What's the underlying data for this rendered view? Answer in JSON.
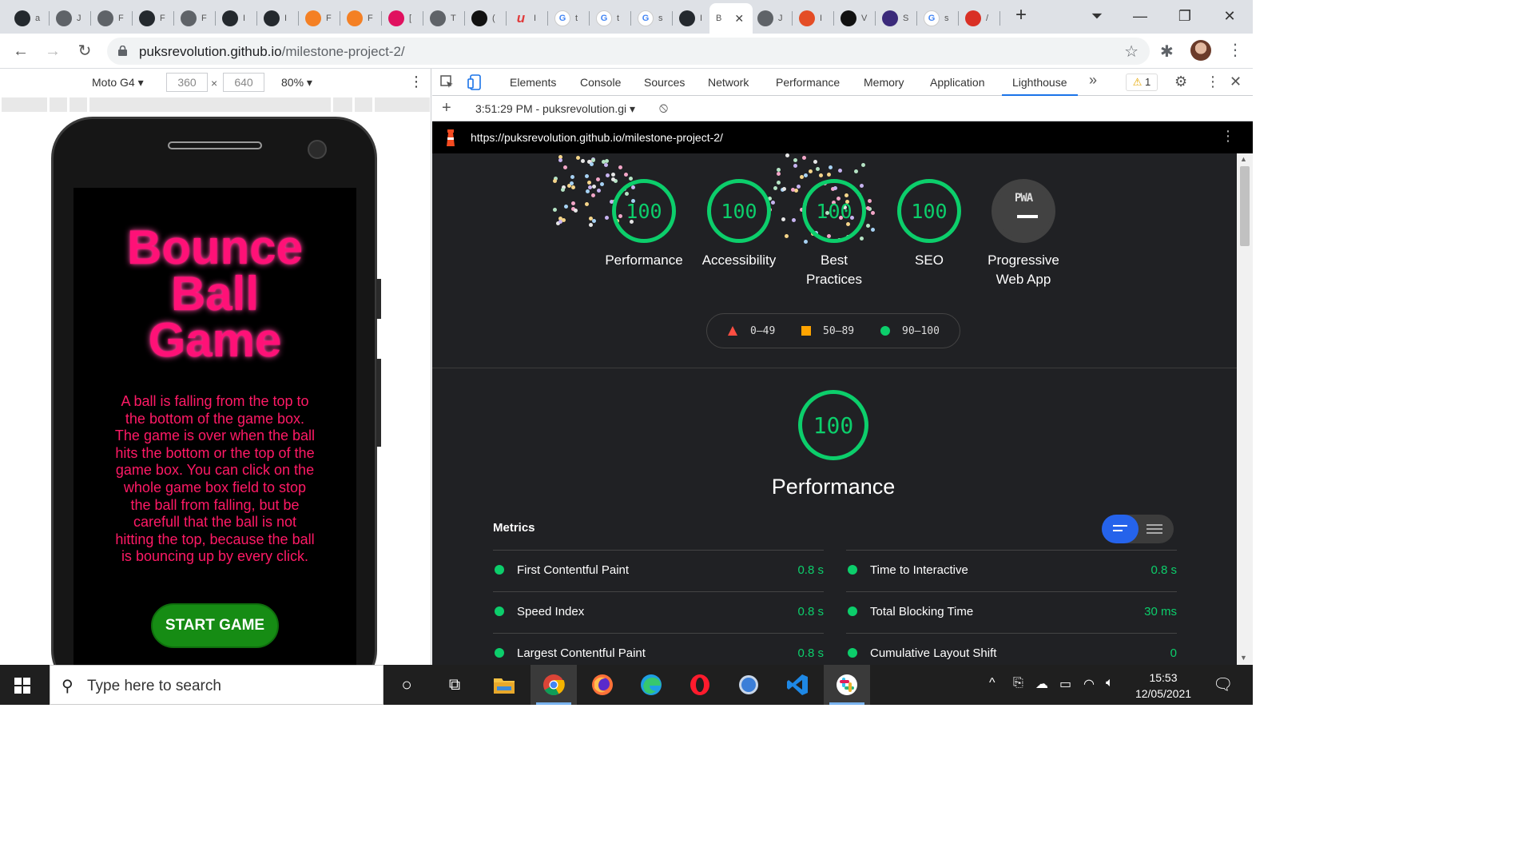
{
  "browser": {
    "tabs": [
      {
        "icon": "github-icon",
        "letter": "a"
      },
      {
        "icon": "globe-icon",
        "letter": "J"
      },
      {
        "icon": "globe-icon",
        "letter": "F"
      },
      {
        "icon": "github-icon",
        "letter": "F"
      },
      {
        "icon": "globe-icon",
        "letter": "F"
      },
      {
        "icon": "github-icon",
        "letter": "I"
      },
      {
        "icon": "github-icon",
        "letter": "I"
      },
      {
        "icon": "orange-g-icon",
        "letter": "F"
      },
      {
        "icon": "orange-g-icon",
        "letter": "F"
      },
      {
        "icon": "pink-square-icon",
        "letter": "["
      },
      {
        "icon": "globe-icon",
        "letter": "T"
      },
      {
        "icon": "codepen-icon",
        "letter": "("
      },
      {
        "icon": "u-icon",
        "letter": "I"
      },
      {
        "icon": "google-icon",
        "letter": "t"
      },
      {
        "icon": "google-icon",
        "letter": "t"
      },
      {
        "icon": "google-icon",
        "letter": "s"
      },
      {
        "icon": "github-icon",
        "letter": "I"
      },
      {
        "icon": "active-tab",
        "letter": "B"
      },
      {
        "icon": "globe-icon",
        "letter": "J"
      },
      {
        "icon": "html5-icon",
        "letter": "I"
      },
      {
        "icon": "dark-icon",
        "letter": "V"
      },
      {
        "icon": "vu-icon",
        "letter": "S"
      },
      {
        "icon": "google-icon",
        "letter": "s"
      },
      {
        "icon": "red-box-icon",
        "letter": "/"
      }
    ],
    "url_host": "puksrevolution.github.io",
    "url_path": "/milestone-project-2/"
  },
  "device": {
    "name": "Moto G4",
    "width": "360",
    "height": "640",
    "zoom": "80%"
  },
  "game": {
    "title_line1": "Bounce",
    "title_line2": "Ball",
    "title_line3": "Game",
    "description": "A ball is falling from the top to the bottom of the game box. The game is over when the ball hits the bottom or the top of the game box. You can click on the whole game box field to stop the ball from falling, but be carefull that the ball is not hitting the top, because the ball is bouncing up by every click.",
    "start_button": "START GAME"
  },
  "devtools": {
    "tabs": [
      "Elements",
      "Console",
      "Sources",
      "Network",
      "Performance",
      "Memory",
      "Application",
      "Lighthouse"
    ],
    "active_tab": "Lighthouse",
    "warnings": "1",
    "report_time": "3:51:29 PM - puksrevolution.gi",
    "report_url": "https://puksrevolution.github.io/milestone-project-2/"
  },
  "lighthouse": {
    "scores": [
      {
        "label": "Performance",
        "value": "100"
      },
      {
        "label": "Accessibility",
        "value": "100"
      },
      {
        "label": "Best Practices",
        "value": "100"
      },
      {
        "label": "SEO",
        "value": "100"
      }
    ],
    "pwa_label": "Progressive Web App",
    "pwa_badge": "PWA",
    "legend": [
      "0–49",
      "50–89",
      "90–100"
    ],
    "section_score": "100",
    "section_title": "Performance",
    "metrics_heading": "Metrics",
    "metrics_left": [
      {
        "name": "First Contentful Paint",
        "value": "0.8 s"
      },
      {
        "name": "Speed Index",
        "value": "0.8 s"
      },
      {
        "name": "Largest Contentful Paint",
        "value": "0.8 s"
      }
    ],
    "metrics_right": [
      {
        "name": "Time to Interactive",
        "value": "0.8 s"
      },
      {
        "name": "Total Blocking Time",
        "value": "30 ms"
      },
      {
        "name": "Cumulative Layout Shift",
        "value": "0"
      }
    ],
    "colors": {
      "pass": "#0cce6b",
      "average": "#ffa400",
      "fail": "#ff4e42"
    }
  },
  "taskbar": {
    "search_placeholder": "Type here to search",
    "time": "15:53",
    "date": "12/05/2021"
  }
}
